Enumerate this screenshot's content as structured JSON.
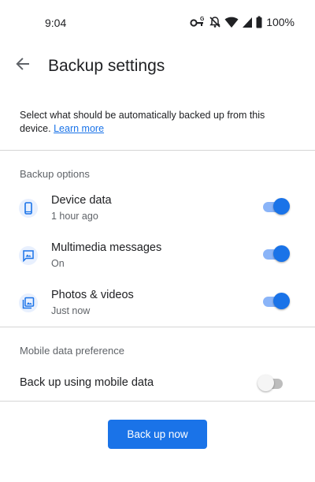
{
  "status_bar": {
    "time": "9:04",
    "battery": "100%",
    "icons": [
      "vpn-key-icon",
      "notifications-off-icon",
      "wifi-icon",
      "cell-signal-icon",
      "battery-icon"
    ]
  },
  "header": {
    "title": "Backup settings",
    "back_icon": "arrow-back-icon"
  },
  "intro": {
    "text": "Select what should be automatically backed up from this device.",
    "link": "Learn more"
  },
  "backup_options": {
    "header": "Backup options",
    "items": [
      {
        "title": "Device data",
        "subtitle": "1 hour ago",
        "icon": "phone-icon",
        "enabled": true
      },
      {
        "title": "Multimedia messages",
        "subtitle": "On",
        "icon": "mms-icon",
        "enabled": true
      },
      {
        "title": "Photos & videos",
        "subtitle": "Just now",
        "icon": "photo-icon",
        "enabled": true
      }
    ]
  },
  "mobile_data": {
    "header": "Mobile data preference",
    "label": "Back up using mobile data",
    "enabled": false
  },
  "actions": {
    "backup_now": "Back up now"
  },
  "colors": {
    "accent": "#1a73e8",
    "accent_light": "#8ab4f8",
    "icon_bg": "#e8f0fe",
    "secondary_text": "#5f6368",
    "divider": "#d5d5d5"
  }
}
